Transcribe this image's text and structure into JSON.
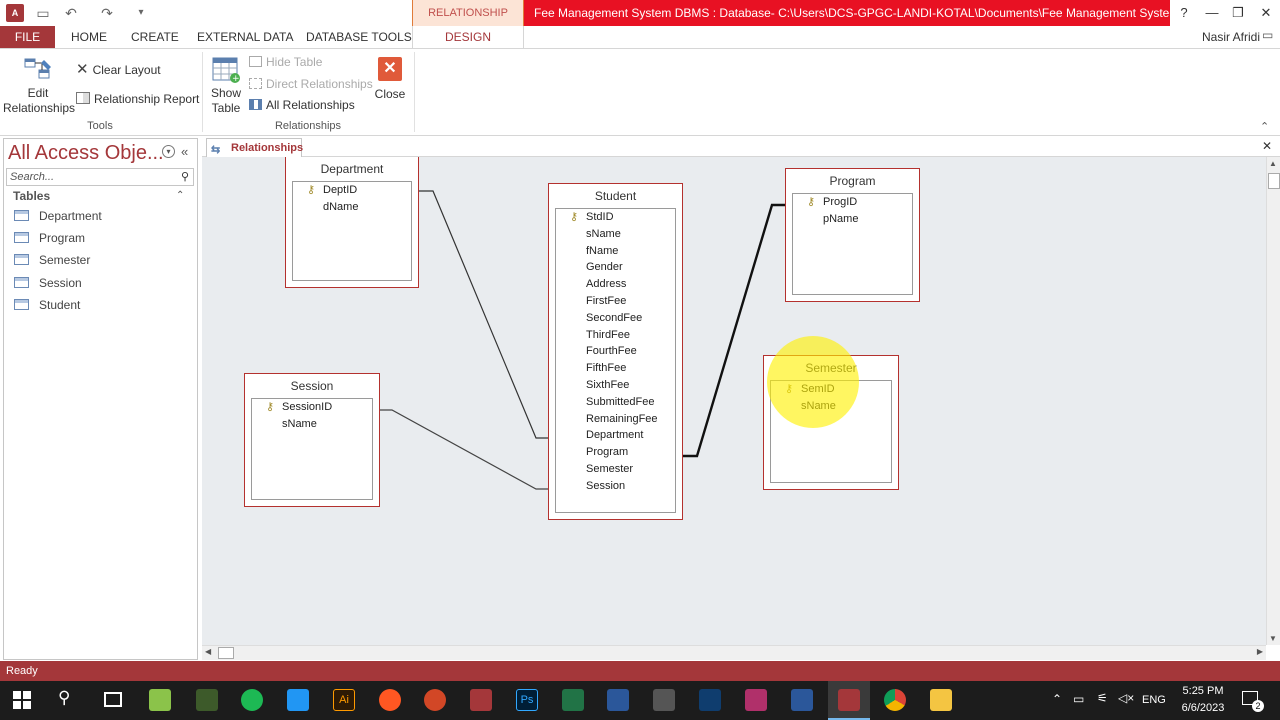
{
  "titlebar": {
    "app_icon": "A",
    "context_tab": "RELATIONSHIP TOOLS",
    "title": "Fee Management System DBMS : Database- C:\\Users\\DCS-GPGC-LANDI-KOTAL\\Documents\\Fee Management System DBMS....",
    "help": "?",
    "minimize": "—",
    "restore": "❐",
    "close": "✕"
  },
  "ribbon_tabs": {
    "file": "FILE",
    "home": "HOME",
    "create": "CREATE",
    "external_data": "EXTERNAL DATA",
    "database_tools": "DATABASE TOOLS",
    "design": "DESIGN",
    "user": "Nasir Afridi"
  },
  "ribbon": {
    "edit_relationships_1": "Edit",
    "edit_relationships_2": "Relationships",
    "clear_layout": "Clear Layout",
    "relationship_report": "Relationship Report",
    "tools_group": "Tools",
    "show_table_1": "Show",
    "show_table_2": "Table",
    "hide_table": "Hide Table",
    "direct_relationships": "Direct Relationships",
    "all_relationships": "All Relationships",
    "close": "Close",
    "relationships_group": "Relationships"
  },
  "nav": {
    "title": "All Access Obje...",
    "search_placeholder": "Search...",
    "section": "Tables",
    "items": [
      "Department",
      "Program",
      "Semester",
      "Session",
      "Student"
    ]
  },
  "doc": {
    "tab_label": "Relationships",
    "close": "✕"
  },
  "tables": {
    "department": {
      "name": "Department",
      "fields": [
        "DeptID",
        "dName"
      ]
    },
    "student": {
      "name": "Student",
      "fields": [
        "StdID",
        "sName",
        "fName",
        "Gender",
        "Address",
        "FirstFee",
        "SecondFee",
        "ThirdFee",
        "FourthFee",
        "FifthFee",
        "SixthFee",
        "SubmittedFee",
        "RemainingFee",
        "Department",
        "Program",
        "Semester",
        "Session"
      ]
    },
    "program": {
      "name": "Program",
      "fields": [
        "ProgID",
        "pName"
      ]
    },
    "session": {
      "name": "Session",
      "fields": [
        "SessionID",
        "sName"
      ]
    },
    "semester": {
      "name": "Semester",
      "fields": [
        "SemID",
        "sName"
      ]
    }
  },
  "status": {
    "text": "Ready"
  },
  "taskbar": {
    "lang": "ENG",
    "time": "5:25 PM",
    "date": "6/6/2023",
    "notifications": "2"
  },
  "colors": {
    "access_red": "#a4373a",
    "title_red": "#e81123",
    "table_border": "#b4312e"
  }
}
